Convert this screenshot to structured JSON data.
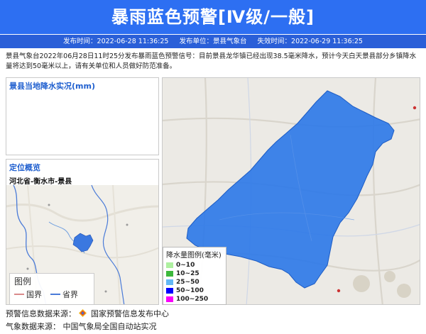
{
  "header": {
    "title": "暴雨蓝色预警[Ⅳ级/一般]",
    "publish_time": "发布时间：2022-06-28 11:36:25",
    "publisher": "发布单位：景县气象台",
    "expire_time": "失效时间：2022-06-29 11:36:25"
  },
  "description": "景县气象台2022年06月28日11时25分发布暴雨蓝色预警信号：目前景县龙华镇已经出现38.5毫米降水，预计今天白天景县部分乡镇降水量将达到50毫米以上，请有关单位和人员做好防范准备。",
  "rainfall_panel": {
    "title": "景县当地降水实况(mm)"
  },
  "location_panel": {
    "title": "定位概览",
    "region": "河北省-衡水市-景县",
    "legend_title": "图例",
    "national_border": "国界",
    "provincial_border": "省界",
    "colors": {
      "national": "#d98a8a",
      "provincial": "#4a7bd8",
      "highlight": "#3b78e0"
    }
  },
  "main_map": {
    "warning_area_color": "#2f7ae8",
    "legend": {
      "title": "降水量图例(毫米)",
      "items": [
        {
          "label": "0~10",
          "color": "#aef0a0"
        },
        {
          "label": "10~25",
          "color": "#3cb83c"
        },
        {
          "label": "25~50",
          "color": "#62b8f6"
        },
        {
          "label": "50~100",
          "color": "#0000fe"
        },
        {
          "label": "100~250",
          "color": "#fa00fa"
        }
      ]
    }
  },
  "footer": {
    "warning_source_label": "预警信息数据来源：",
    "warning_source": "国家预警信息发布中心",
    "weather_source_label": "气象数据来源：",
    "weather_source": "中国气象局全国自动站实况"
  }
}
